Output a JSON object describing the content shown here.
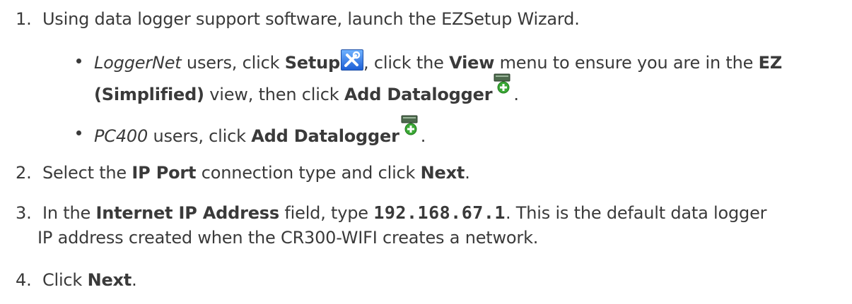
{
  "steps": [
    {
      "num": "1.",
      "text": "Using data logger support software, launch the EZSetup Wizard."
    },
    {
      "num": "2.",
      "parts": [
        "Select the ",
        "IP Port",
        " connection type and click ",
        "Next",
        "."
      ]
    },
    {
      "num": "3.",
      "parts": [
        "In the ",
        "Internet IP Address",
        " field, type ",
        "192.168.67.1",
        ". This is the default data logger"
      ],
      "cont": "IP address created when the CR300-WIFI creates a network."
    },
    {
      "num": "4.",
      "parts": [
        "Click ",
        "Next",
        "."
      ]
    }
  ],
  "bullets": [
    {
      "line1": [
        "LoggerNet",
        " users, click ",
        "Setup",
        ", click the ",
        "View",
        " menu to ensure you are in the ",
        "EZ"
      ],
      "line2": [
        "(Simplified)",
        " view, then click ",
        "Add Datalogger",
        "."
      ]
    },
    {
      "line1": [
        "PC400",
        " users, click ",
        "Add Datalogger",
        "."
      ]
    }
  ],
  "icons": {
    "setup": "setup-tools-icon",
    "add_datalogger": "add-datalogger-icon"
  },
  "colors": {
    "text": "#3a3a3a",
    "setup_icon": "#1d5fd6",
    "add_icon_green": "#3aa935"
  }
}
